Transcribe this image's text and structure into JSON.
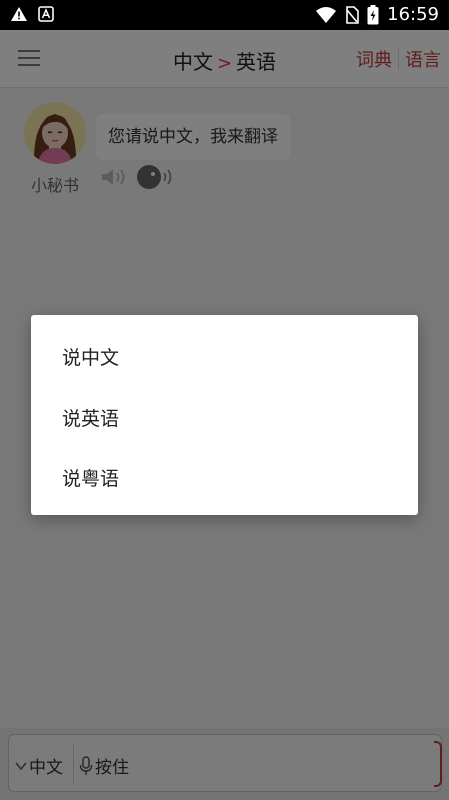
{
  "status_bar": {
    "time": "16:59",
    "icons": [
      "warning-icon",
      "a-icon",
      "wifi-icon",
      "no-sim-icon",
      "battery-charging-icon"
    ]
  },
  "header": {
    "source_lang": "中文",
    "arrow": ">",
    "target_lang": "英语",
    "dictionary_label": "词典",
    "language_label": "语言"
  },
  "chat": {
    "assistant_name": "小秘书",
    "message": "您请说中文，我来翻译"
  },
  "bottom": {
    "lang_selector": "中文",
    "hold_to_talk": "按住"
  },
  "dialog": {
    "options": [
      "说中文",
      "说英语",
      "说粤语"
    ]
  },
  "colors": {
    "accent": "#c23b3b",
    "arrow": "#d93a3a",
    "overlay": "rgba(0,0,0,0.5)"
  }
}
